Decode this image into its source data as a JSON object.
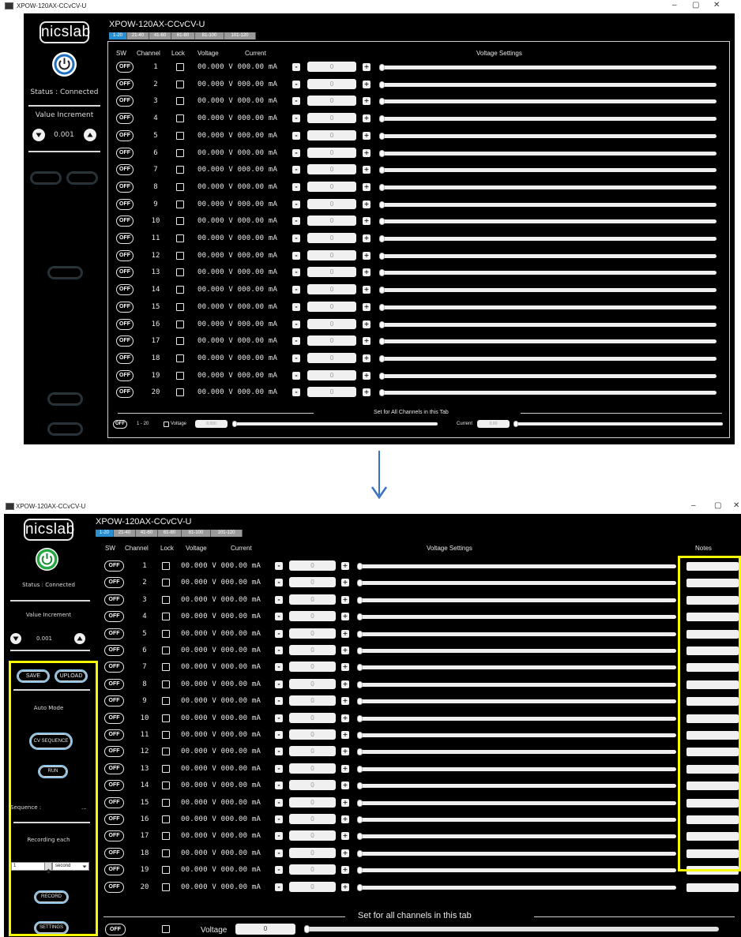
{
  "top": {
    "window_title": "XPOW-120AX-CCvCV-U",
    "logo": "nicslab",
    "device_title": "XPOW-120AX-CCvCV-U",
    "tabs": [
      "1-20",
      "21-40",
      "41-60",
      "61-80",
      "81-100",
      "101-120"
    ],
    "active_tab": 0,
    "status": "Status : Connected",
    "value_increment_label": "Value Increment",
    "increment_value": "0.001",
    "headers": {
      "sw": "SW",
      "channel": "Channel",
      "lock": "Lock",
      "voltage": "Voltage",
      "current": "Current",
      "voltage_settings": "Voltage Settings"
    },
    "footer": {
      "title": "Set for All Channels in this Tab",
      "off": "OFF",
      "range": "1 - 20",
      "voltage_label": "Voltage",
      "voltage_value": "0.000",
      "current_label": "Current",
      "current_value": "0.00"
    }
  },
  "bottom": {
    "window_title": "XPOW-120AX-CCvCV-U",
    "logo": "nicslab",
    "device_title": "XPOW-120AX-CCvCV-U",
    "tabs": [
      "1-20",
      "21-40",
      "41-60",
      "61-80",
      "81-100",
      "101-120"
    ],
    "active_tab": 0,
    "status": "Status : Connected",
    "value_increment_label": "Value Increment",
    "increment_value": "0.001",
    "save": "SAVE",
    "upload": "UPLOAD",
    "auto_mode": "Auto Mode",
    "cv_sequence": "CV SEQUENCE",
    "run": "RUN",
    "sequence_label": "Sequence :",
    "sequence_value": "...",
    "recording_each": "Recording each",
    "recording_value": "1",
    "recording_unit": "second",
    "record": "RECORD",
    "settings": "SETTINGS",
    "headers": {
      "sw": "SW",
      "channel": "Channel",
      "lock": "Lock",
      "voltage": "Voltage",
      "current": "Current",
      "voltage_settings": "Voltage Settings",
      "notes": "Notes"
    },
    "footer": {
      "title": "Set for all channels in this tab",
      "off": "OFF",
      "voltage_label": "Voltage",
      "voltage_value": "0"
    }
  },
  "rows": {
    "off_label": "OFF",
    "reading": "00.000 V 000.00 mA",
    "minus": "-",
    "plus": "+",
    "setpoint": "0",
    "channels": [
      "1",
      "2",
      "3",
      "4",
      "5",
      "6",
      "7",
      "8",
      "9",
      "10",
      "11",
      "12",
      "13",
      "14",
      "15",
      "16",
      "17",
      "18",
      "19",
      "20"
    ]
  },
  "window_controls": {
    "minimize": "–",
    "maximize": "▢",
    "close": "✕"
  },
  "colors": {
    "highlight": "#f6f900",
    "active_tab": "#2a8fd0",
    "arrow": "#3a6fc2",
    "power_ring_top": "#1e6fbf",
    "power_ring_bottom": "#28a745"
  }
}
